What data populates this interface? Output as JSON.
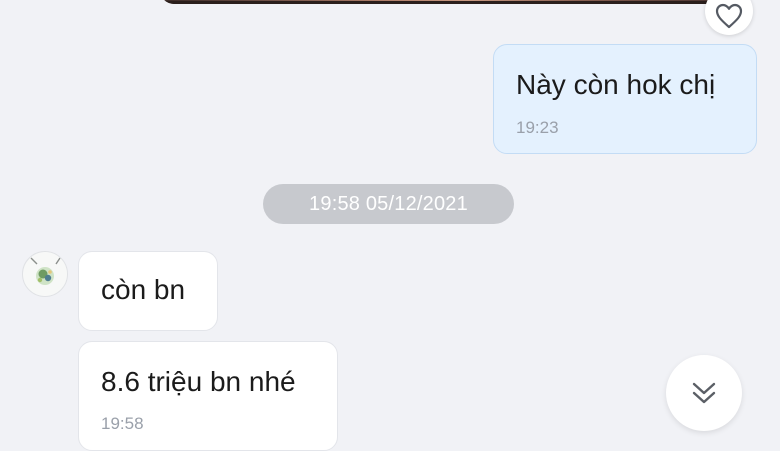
{
  "messages": [
    {
      "direction": "outgoing",
      "text": "Này còn hok chị",
      "time": "19:23"
    },
    {
      "direction": "incoming",
      "text": "còn bn",
      "time": ""
    },
    {
      "direction": "incoming",
      "text": "8.6 triệu bn nhé",
      "time": "19:58"
    }
  ],
  "date_separator": "19:58 05/12/2021",
  "icons": {
    "reaction": "heart-icon",
    "scroll": "chevrons-down-icon",
    "avatar": "contact-avatar"
  },
  "colors": {
    "background": "#f1f2f6",
    "outgoing_bubble": "#e4f1fe",
    "incoming_bubble": "#ffffff",
    "date_pill": "#c7c9ce"
  }
}
